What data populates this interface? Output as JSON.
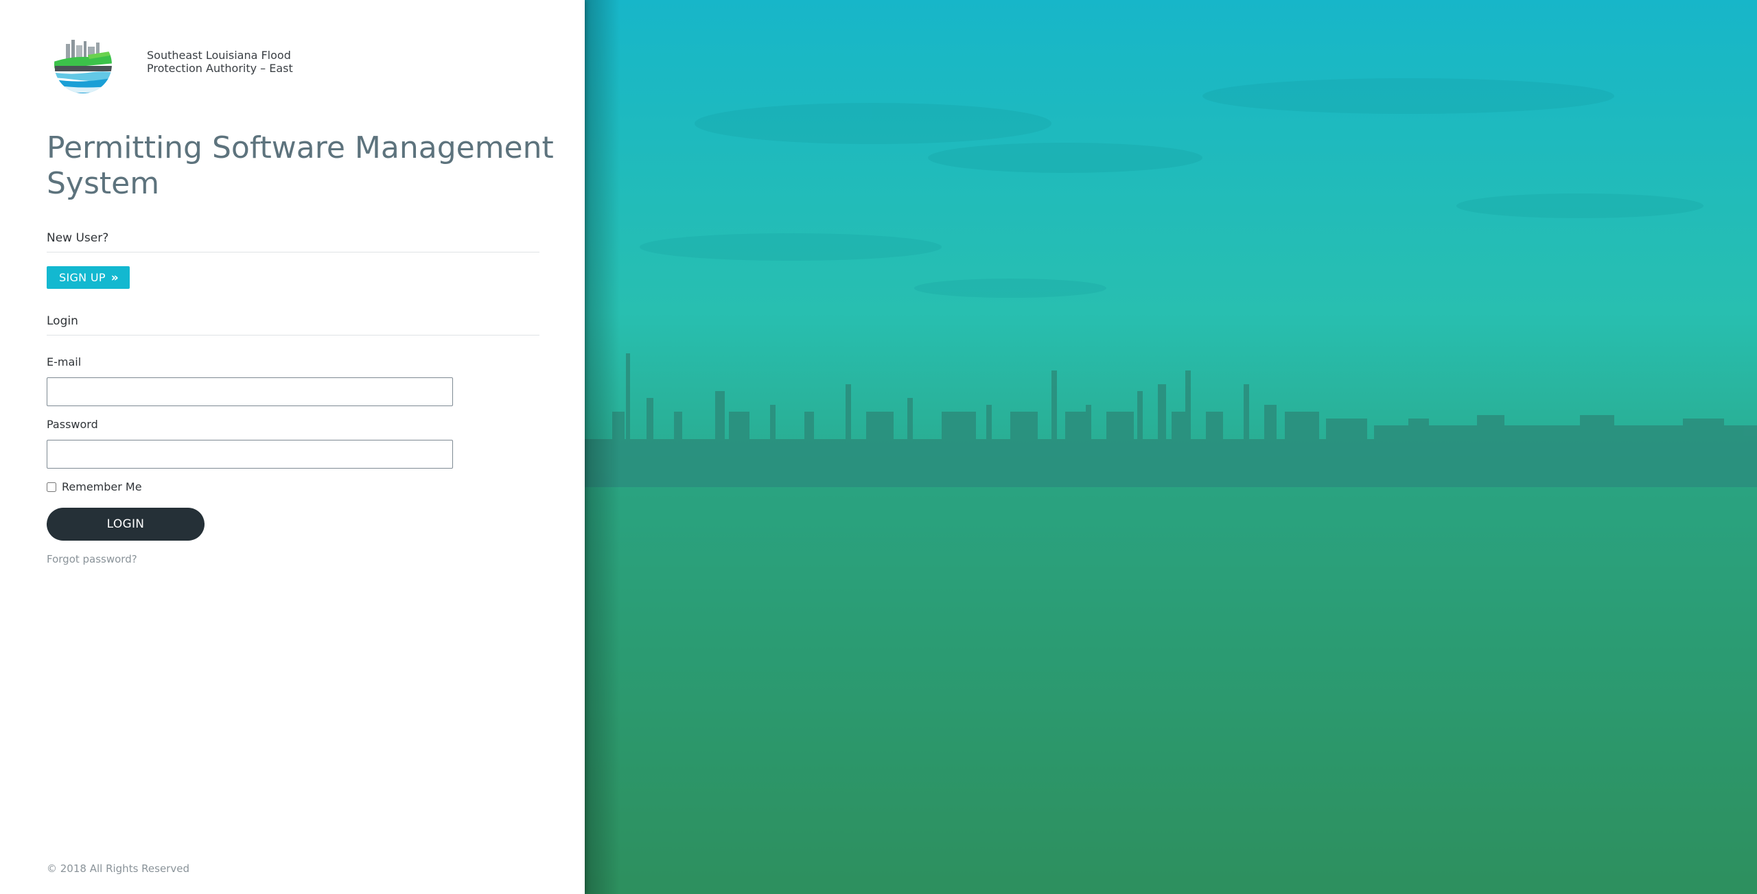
{
  "brand": {
    "org_name": "Southeast Louisiana Flood\nProtection Authority – East",
    "logo_icon": "flood-authority-logo"
  },
  "page_title": "Permitting Software Management System",
  "new_user": {
    "heading": "New User?",
    "signup_label": "SIGN UP",
    "signup_icon": "double-chevron-right-icon"
  },
  "login": {
    "heading": "Login",
    "email_label": "E-mail",
    "email_value": "",
    "password_label": "Password",
    "password_value": "",
    "remember_label": "Remember Me",
    "remember_checked": false,
    "button_label": "LOGIN",
    "forgot_label": "Forgot password?"
  },
  "footer": {
    "copyright": "© 2018 All Rights Reserved"
  },
  "colors": {
    "accent": "#13b8d0",
    "login_button": "#253037",
    "title": "#5d737d",
    "hero_top": "#17b6c9",
    "hero_bottom": "#2f8a55"
  }
}
